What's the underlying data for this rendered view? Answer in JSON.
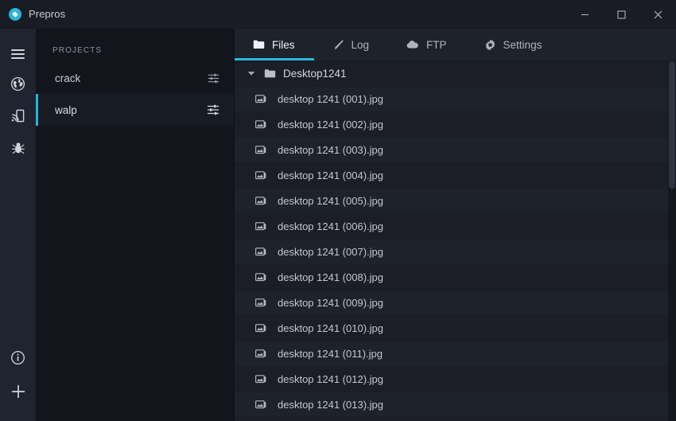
{
  "window": {
    "title": "Prepros",
    "logo_icon": "prepros-logo-icon",
    "controls": [
      {
        "name": "minimize",
        "icon": "minimize-icon"
      },
      {
        "name": "maximize",
        "icon": "maximize-icon"
      },
      {
        "name": "close",
        "icon": "close-icon"
      }
    ]
  },
  "rail": {
    "top_items": [
      {
        "name": "menu",
        "icon": "hamburger-menu-icon"
      },
      {
        "name": "browser",
        "icon": "globe-icon"
      },
      {
        "name": "device-preview",
        "icon": "device-cast-icon"
      },
      {
        "name": "debug",
        "icon": "bug-icon"
      }
    ],
    "bottom_items": [
      {
        "name": "info",
        "icon": "info-circle-icon"
      },
      {
        "name": "add-project",
        "icon": "plus-icon"
      }
    ]
  },
  "projects": {
    "header": "PROJECTS",
    "items": [
      {
        "label": "crack",
        "active": false,
        "settings_icon": "sliders-icon"
      },
      {
        "label": "walp",
        "active": true,
        "settings_icon": "sliders-icon"
      }
    ]
  },
  "tabs": [
    {
      "label": "Files",
      "icon": "folder-icon",
      "active": true
    },
    {
      "label": "Log",
      "icon": "pencil-icon",
      "active": false
    },
    {
      "label": "FTP",
      "icon": "cloud-icon",
      "active": false
    },
    {
      "label": "Settings",
      "icon": "gear-icon",
      "active": false
    }
  ],
  "files": {
    "folder": {
      "label": "Desktop1241",
      "expanded": true,
      "icon": "folder-icon"
    },
    "items": [
      {
        "label": "desktop 1241 (001).jpg",
        "icon": "image-file-icon"
      },
      {
        "label": "desktop 1241 (002).jpg",
        "icon": "image-file-icon"
      },
      {
        "label": "desktop 1241 (003).jpg",
        "icon": "image-file-icon"
      },
      {
        "label": "desktop 1241 (004).jpg",
        "icon": "image-file-icon"
      },
      {
        "label": "desktop 1241 (005).jpg",
        "icon": "image-file-icon"
      },
      {
        "label": "desktop 1241 (006).jpg",
        "icon": "image-file-icon"
      },
      {
        "label": "desktop 1241 (007).jpg",
        "icon": "image-file-icon"
      },
      {
        "label": "desktop 1241 (008).jpg",
        "icon": "image-file-icon"
      },
      {
        "label": "desktop 1241 (009).jpg",
        "icon": "image-file-icon"
      },
      {
        "label": "desktop 1241 (010).jpg",
        "icon": "image-file-icon"
      },
      {
        "label": "desktop 1241 (011).jpg",
        "icon": "image-file-icon"
      },
      {
        "label": "desktop 1241 (012).jpg",
        "icon": "image-file-icon"
      },
      {
        "label": "desktop 1241 (013).jpg",
        "icon": "image-file-icon"
      }
    ]
  },
  "colors": {
    "accent": "#2ab4d8",
    "titlebar_bg": "#191c24",
    "rail_bg": "#20242e",
    "projects_bg": "#12151c",
    "main_bg": "#1b1e26",
    "row_alt_bg": "#1e222b",
    "text": "#c3c7d0"
  }
}
